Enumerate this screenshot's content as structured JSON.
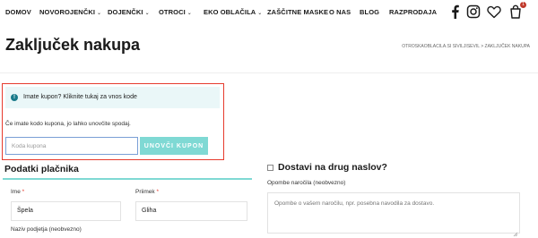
{
  "nav": {
    "items": [
      {
        "label": "DOMOV",
        "has_caret": false
      },
      {
        "label": "NOVOROJENČKI",
        "has_caret": true
      },
      {
        "label": "DOJENČKI",
        "has_caret": true
      },
      {
        "label": "OTROCI",
        "has_caret": true
      },
      {
        "label": "EKO OBLAČILA",
        "has_caret": true
      },
      {
        "label": "ZAŠČITNE MASKE",
        "has_caret": false
      },
      {
        "label": "O NAS",
        "has_caret": false
      },
      {
        "label": "BLOG",
        "has_caret": false
      },
      {
        "label": "RAZPRODAJA",
        "has_caret": false
      }
    ],
    "caret": "⌄",
    "icons": [
      "facebook-icon",
      "instagram-icon",
      "heart-icon",
      "cart-icon"
    ],
    "cart_count": "1"
  },
  "header": {
    "title": "Zaključek nakupa",
    "breadcrumb": "OTROSKAOBLACILA.SI SIVILJISEVIL > ZAKLJUČEK NAKUPA"
  },
  "coupon": {
    "info_prefix": "Imate kupon? ",
    "info_link": "Kliknite tukaj za vnos kode",
    "help_text": "Če imate kodo kupona, jo lahko unovčite spodaj.",
    "input_placeholder": "Koda kupona",
    "button_label": "UNOVČI KUPON"
  },
  "billing": {
    "title": "Podatki plačnika",
    "first_name_label": "Ime",
    "first_name_value": "Špela",
    "last_name_label": "Priimek",
    "last_name_value": "Gliha",
    "company_label": "Naziv podjetja (neobvezno)",
    "required_mark": "*"
  },
  "shipping": {
    "title": "Dostavi na drug naslov?",
    "notes_label": "Opombe naročila (neobvezno)",
    "notes_placeholder": "Opombe o vašem naročilu, npr. posebna navodila za dostavo."
  },
  "colors": {
    "accent_teal": "#7fd9d4",
    "highlight_red": "#e63b2e",
    "info_bg": "#eaf7f8",
    "badge": "#c0392b"
  }
}
